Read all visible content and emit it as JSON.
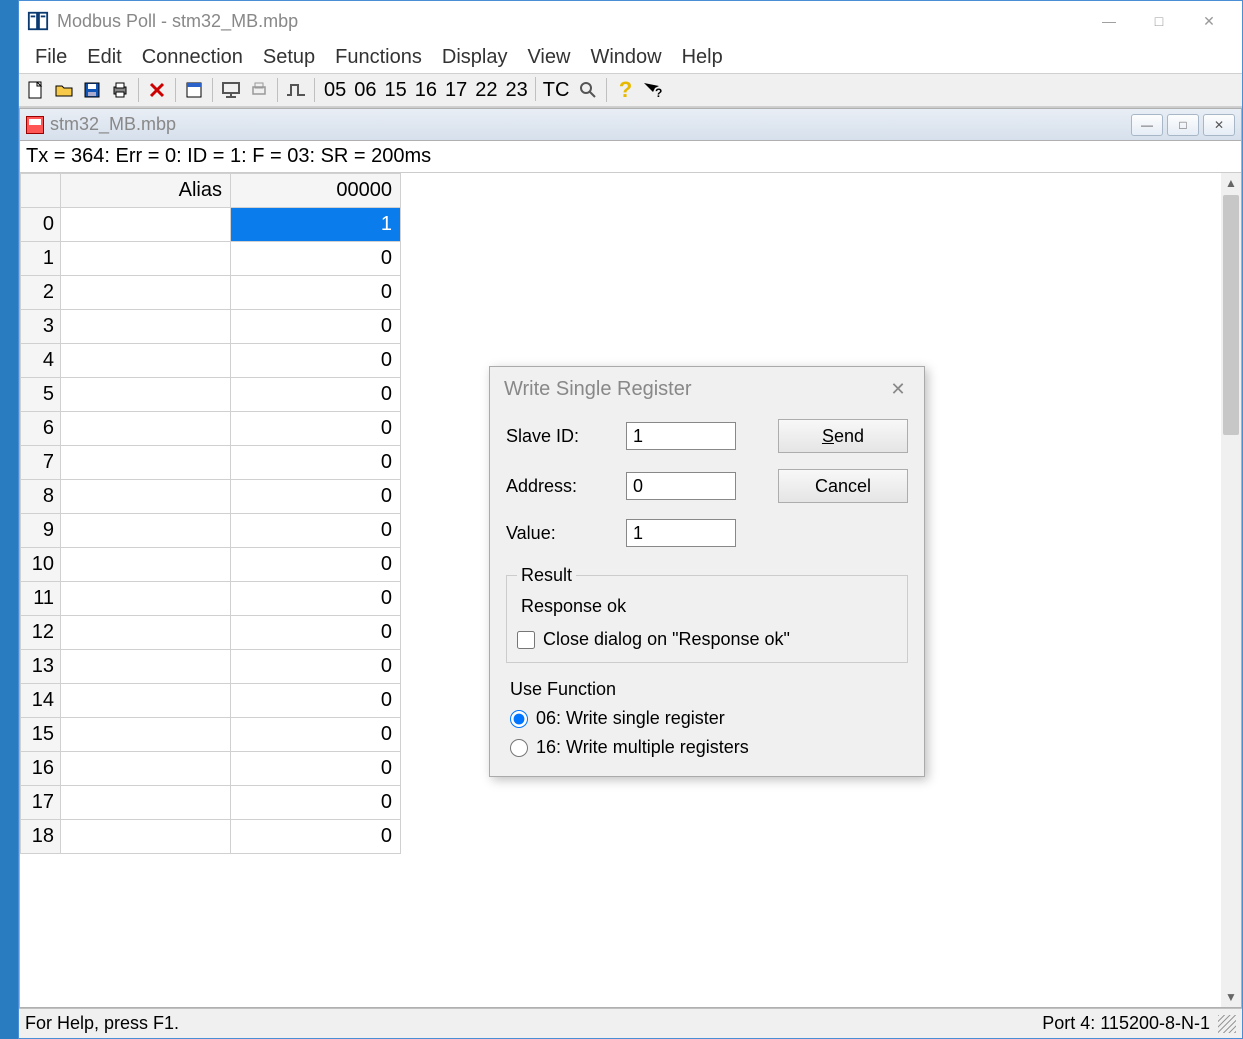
{
  "app_title": "Modbus Poll - stm32_MB.mbp",
  "menu": [
    "File",
    "Edit",
    "Connection",
    "Setup",
    "Functions",
    "Display",
    "View",
    "Window",
    "Help"
  ],
  "toolbar_text": [
    "05",
    "06",
    "15",
    "16",
    "17",
    "22",
    "23",
    "TC"
  ],
  "child_title": "stm32_MB.mbp",
  "status_line": "Tx = 364: Err = 0: ID = 1: F = 03: SR = 200ms",
  "grid": {
    "columns": [
      "Alias",
      "00000"
    ],
    "rows": [
      {
        "idx": "0",
        "alias": "",
        "val": "1",
        "selected": true
      },
      {
        "idx": "1",
        "alias": "",
        "val": "0"
      },
      {
        "idx": "2",
        "alias": "",
        "val": "0"
      },
      {
        "idx": "3",
        "alias": "",
        "val": "0"
      },
      {
        "idx": "4",
        "alias": "",
        "val": "0"
      },
      {
        "idx": "5",
        "alias": "",
        "val": "0"
      },
      {
        "idx": "6",
        "alias": "",
        "val": "0"
      },
      {
        "idx": "7",
        "alias": "",
        "val": "0"
      },
      {
        "idx": "8",
        "alias": "",
        "val": "0"
      },
      {
        "idx": "9",
        "alias": "",
        "val": "0"
      },
      {
        "idx": "10",
        "alias": "",
        "val": "0"
      },
      {
        "idx": "11",
        "alias": "",
        "val": "0"
      },
      {
        "idx": "12",
        "alias": "",
        "val": "0"
      },
      {
        "idx": "13",
        "alias": "",
        "val": "0"
      },
      {
        "idx": "14",
        "alias": "",
        "val": "0"
      },
      {
        "idx": "15",
        "alias": "",
        "val": "0"
      },
      {
        "idx": "16",
        "alias": "",
        "val": "0"
      },
      {
        "idx": "17",
        "alias": "",
        "val": "0"
      },
      {
        "idx": "18",
        "alias": "",
        "val": "0"
      }
    ]
  },
  "dialog": {
    "title": "Write Single Register",
    "slave_id_label": "Slave ID:",
    "slave_id_value": "1",
    "address_label": "Address:",
    "address_value": "0",
    "value_label": "Value:",
    "value_value": "1",
    "send_label": "Send",
    "cancel_label": "Cancel",
    "result_legend": "Result",
    "result_text": "Response ok",
    "close_on_ok_label": "Close dialog on \"Response ok\"",
    "use_function_label": "Use Function",
    "radio06": "06: Write single register",
    "radio16": "16: Write multiple registers"
  },
  "statusbar": {
    "help_text": "For Help, press F1.",
    "port_text": "Port 4: 115200-8-N-1"
  }
}
